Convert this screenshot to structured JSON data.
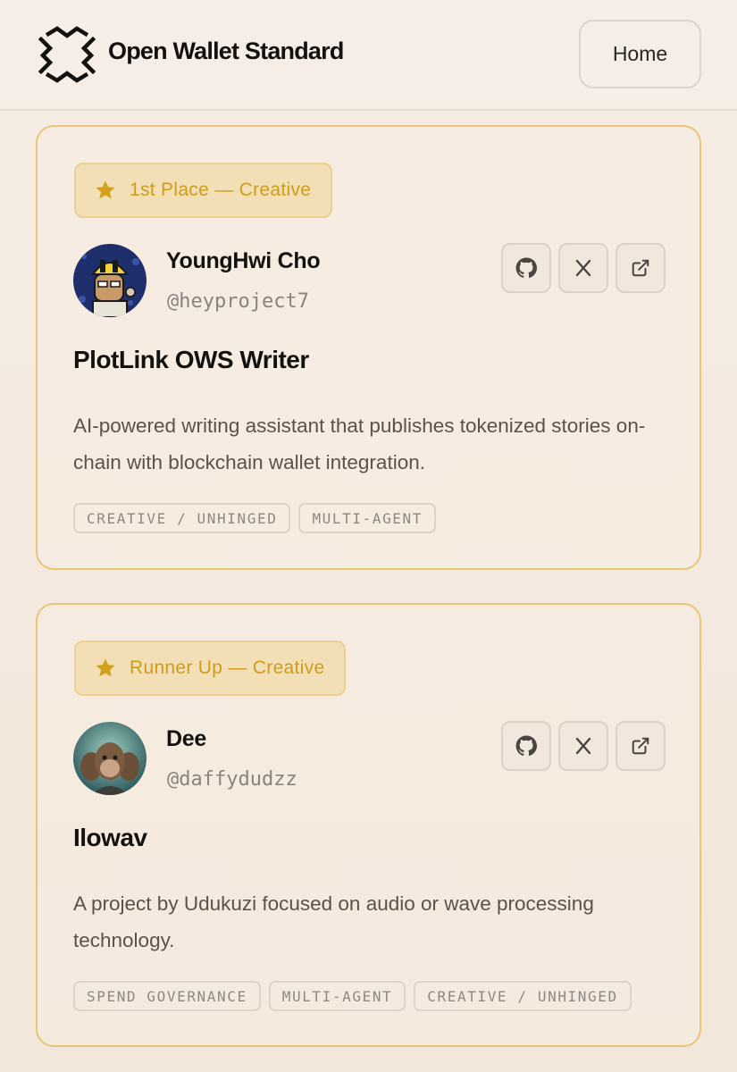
{
  "header": {
    "brand": "Open Wallet Standard",
    "home_label": "Home"
  },
  "colors": {
    "accent": "#cf9d1a",
    "card_border": "#e9c575",
    "badge_bg": "#f2dfb5"
  },
  "cards": [
    {
      "badge": "1st Place — Creative",
      "name": "YoungHwi Cho",
      "handle": "@heyproject7",
      "project": "PlotLink OWS Writer",
      "description": "AI-powered writing assistant that publishes tokenized stories on-chain with blockchain wallet integration.",
      "tags": [
        "CREATIVE / UNHINGED",
        "MULTI-AGENT"
      ],
      "links": [
        "github-icon",
        "x-icon",
        "external-link-icon"
      ]
    },
    {
      "badge": "Runner Up — Creative",
      "name": "Dee",
      "handle": "@daffydudzz",
      "project": "Ilowav",
      "description": "A project by Udukuzi focused on audio or wave processing technology.",
      "tags": [
        "SPEND GOVERNANCE",
        "MULTI-AGENT",
        "CREATIVE / UNHINGED"
      ],
      "links": [
        "github-icon",
        "x-icon",
        "external-link-icon"
      ]
    }
  ]
}
